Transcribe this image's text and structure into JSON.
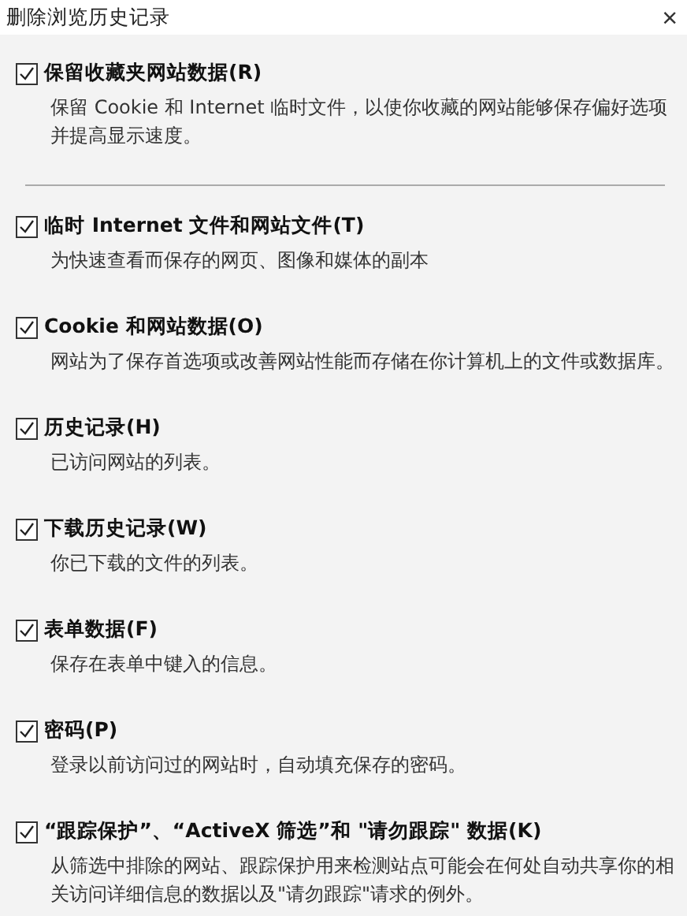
{
  "window": {
    "title": "删除浏览历史记录",
    "close": "×"
  },
  "options": [
    {
      "label": "保留收藏夹网站数据(R)",
      "description": "保留 Cookie 和 Internet 临时文件，以使你收藏的网站能够保存偏好选项并提高显示速度。",
      "checked": true,
      "separator_after": true
    },
    {
      "label": "临时 Internet 文件和网站文件(T)",
      "description": "为快速查看而保存的网页、图像和媒体的副本",
      "checked": true
    },
    {
      "label": "Cookie 和网站数据(O)",
      "description": "网站为了保存首选项或改善网站性能而存储在你计算机上的文件或数据库。",
      "checked": true
    },
    {
      "label": "历史记录(H)",
      "description": "已访问网站的列表。",
      "checked": true
    },
    {
      "label": "下载历史记录(W)",
      "description": "你已下载的文件的列表。",
      "checked": true
    },
    {
      "label": "表单数据(F)",
      "description": "保存在表单中键入的信息。",
      "checked": true
    },
    {
      "label": "密码(P)",
      "description": "登录以前访问过的网站时，自动填充保存的密码。",
      "checked": true
    },
    {
      "label": "“跟踪保护”、“ActiveX 筛选”和 \"请勿跟踪\" 数据(K)",
      "description": "从筛选中排除的网站、跟踪保护用来检测站点可能会在何处自动共享你的相关访问详细信息的数据以及\"请勿跟踪\"请求的例外。",
      "checked": true
    }
  ]
}
